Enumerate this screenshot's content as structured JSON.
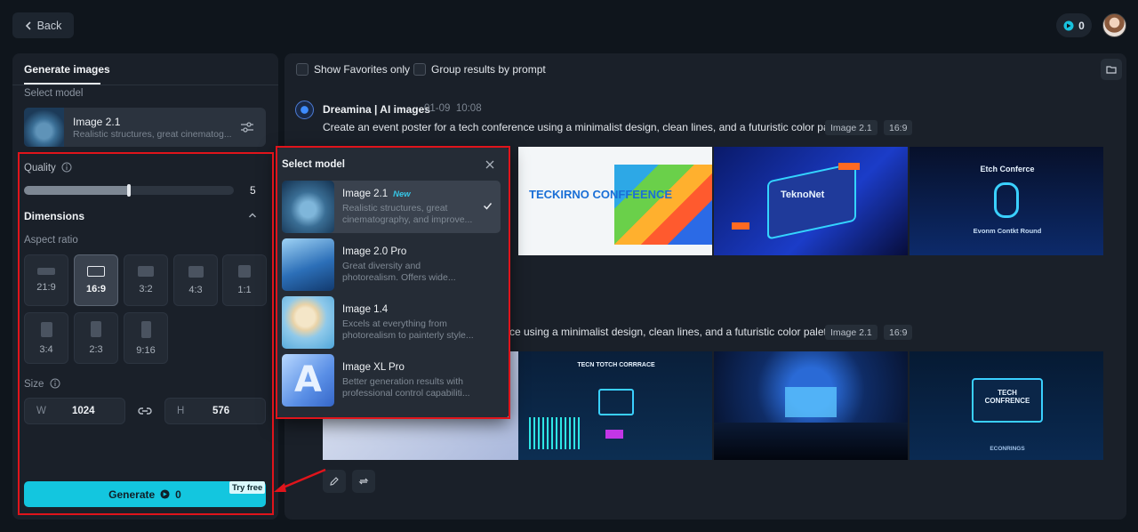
{
  "topbar": {
    "back_label": "Back",
    "credits": "0"
  },
  "left": {
    "tab_label": "Generate images",
    "select_model_label": "Select model",
    "model": {
      "name": "Image 2.1",
      "desc": "Realistic structures, great cinematog..."
    },
    "quality_label": "Quality",
    "quality_value": "5",
    "quality_fraction": 0.5,
    "dimensions_label": "Dimensions",
    "aspect_label": "Aspect ratio",
    "ratios": [
      "21:9",
      "16:9",
      "3:2",
      "4:3",
      "1:1",
      "3:4",
      "2:3",
      "9:16"
    ],
    "selected_ratio": "16:9",
    "size_label": "Size",
    "width_key": "W",
    "width_value": "1024",
    "height_key": "H",
    "height_value": "576",
    "generate_label": "Generate",
    "generate_cost": "0",
    "try_free_label": "Try free"
  },
  "results": {
    "show_favorites_label": "Show Favorites only",
    "group_label": "Group results by prompt",
    "brand_name": "Dreamina | AI images",
    "date": "01-09",
    "time": "10:08",
    "prompt_1": "Create an event poster for a tech conference using a minimalist design, clean lines, and a futuristic color palette.",
    "prompt_2": "ce using a minimalist design, clean lines, and a futuristic color palette.",
    "tag_model": "Image 2.1",
    "tag_ratio": "16:9",
    "row1_texts": [
      "TECKIRNO CONFFEENCE",
      "TeknoNet",
      "Etch Conferce",
      "Evonm Contkt Round"
    ],
    "row2_texts": [
      "TECN TOTCH CORRRACE",
      "TECH CONFRENCE",
      "ECONRINGS"
    ]
  },
  "popup": {
    "title": "Select model",
    "items": [
      {
        "name": "Image 2.1",
        "badge": "New",
        "desc": "Realistic structures, great cinematography, and improve..."
      },
      {
        "name": "Image 2.0 Pro",
        "badge": "",
        "desc": "Great diversity and photorealism. Offers wide..."
      },
      {
        "name": "Image 1.4",
        "badge": "",
        "desc": "Excels at everything from photorealism to painterly style..."
      },
      {
        "name": "Image XL Pro",
        "badge": "",
        "desc": "Better generation results with professional control capabiliti..."
      }
    ]
  },
  "colors": {
    "accent": "#13c6df",
    "highlight": "#e0141b",
    "background": "#0f151c",
    "panel": "#1a2029"
  }
}
